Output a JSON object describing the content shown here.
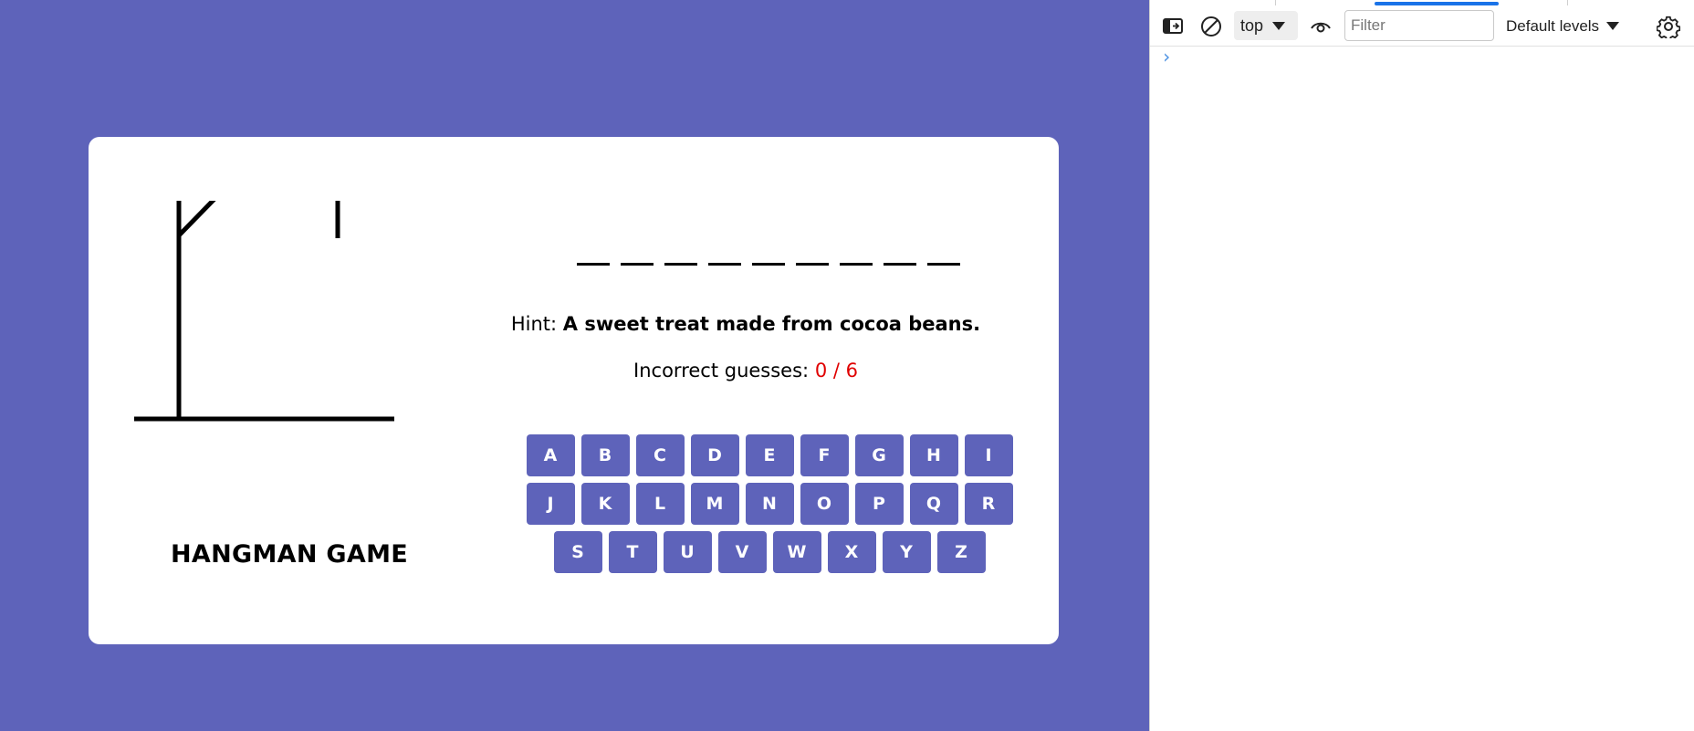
{
  "game": {
    "title": "HANGMAN GAME",
    "word_length": 9,
    "hint_label": "Hint:",
    "hint_text": "A sweet treat made from cocoa beans.",
    "guesses_label": "Incorrect guesses:",
    "guesses_value": "0 / 6",
    "keyboard_rows": [
      [
        "A",
        "B",
        "C",
        "D",
        "E",
        "F",
        "G",
        "H",
        "I"
      ],
      [
        "J",
        "K",
        "L",
        "M",
        "N",
        "O",
        "P",
        "Q",
        "R"
      ],
      [
        "S",
        "T",
        "U",
        "V",
        "W",
        "X",
        "Y",
        "Z"
      ]
    ]
  },
  "colors": {
    "background": "#5e63ba",
    "card": "#ffffff",
    "key": "#5e63ba",
    "guess_count": "#e00000",
    "devtools_accent": "#1a73e8"
  },
  "devtools": {
    "context_select": "top",
    "filter_placeholder": "Filter",
    "levels_select": "Default levels",
    "prompt_glyph": "›",
    "icons": [
      "sidebar-toggle-icon",
      "clear-console-icon",
      "eye-icon",
      "gear-icon",
      "chevron-down-icon"
    ]
  }
}
